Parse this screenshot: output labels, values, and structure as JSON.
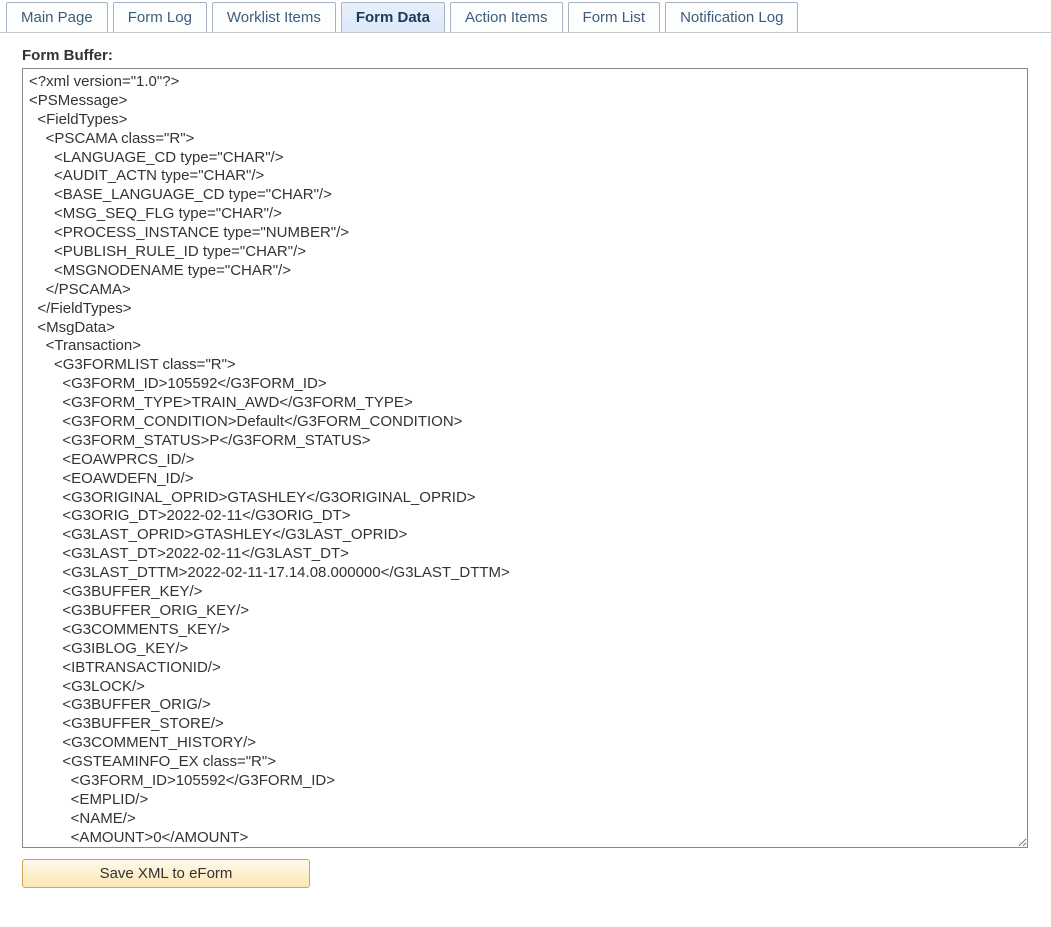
{
  "tabs": [
    {
      "label": "Main Page",
      "active": false
    },
    {
      "label": "Form Log",
      "active": false
    },
    {
      "label": "Worklist Items",
      "active": false
    },
    {
      "label": "Form Data",
      "active": true
    },
    {
      "label": "Action Items",
      "active": false
    },
    {
      "label": "Form List",
      "active": false
    },
    {
      "label": "Notification Log",
      "active": false
    }
  ],
  "buffer_label": "Form Buffer:",
  "save_button_label": "Save XML to eForm",
  "xml_content": "<?xml version=\"1.0\"?>\n<PSMessage>\n  <FieldTypes>\n    <PSCAMA class=\"R\">\n      <LANGUAGE_CD type=\"CHAR\"/>\n      <AUDIT_ACTN type=\"CHAR\"/>\n      <BASE_LANGUAGE_CD type=\"CHAR\"/>\n      <MSG_SEQ_FLG type=\"CHAR\"/>\n      <PROCESS_INSTANCE type=\"NUMBER\"/>\n      <PUBLISH_RULE_ID type=\"CHAR\"/>\n      <MSGNODENAME type=\"CHAR\"/>\n    </PSCAMA>\n  </FieldTypes>\n  <MsgData>\n    <Transaction>\n      <G3FORMLIST class=\"R\">\n        <G3FORM_ID>105592</G3FORM_ID>\n        <G3FORM_TYPE>TRAIN_AWD</G3FORM_TYPE>\n        <G3FORM_CONDITION>Default</G3FORM_CONDITION>\n        <G3FORM_STATUS>P</G3FORM_STATUS>\n        <EOAWPRCS_ID/>\n        <EOAWDEFN_ID/>\n        <G3ORIGINAL_OPRID>GTASHLEY</G3ORIGINAL_OPRID>\n        <G3ORIG_DT>2022-02-11</G3ORIG_DT>\n        <G3LAST_OPRID>GTASHLEY</G3LAST_OPRID>\n        <G3LAST_DT>2022-02-11</G3LAST_DT>\n        <G3LAST_DTTM>2022-02-11-17.14.08.000000</G3LAST_DTTM>\n        <G3BUFFER_KEY/>\n        <G3BUFFER_ORIG_KEY/>\n        <G3COMMENTS_KEY/>\n        <G3IBLOG_KEY/>\n        <IBTRANSACTIONID/>\n        <G3LOCK/>\n        <G3BUFFER_ORIG/>\n        <G3BUFFER_STORE/>\n        <G3COMMENT_HISTORY/>\n        <GSTEAMINFO_EX class=\"R\">\n          <G3FORM_ID>105592</G3FORM_ID>\n          <EMPLID/>\n          <NAME/>\n          <AMOUNT>0</AMOUNT>\n"
}
